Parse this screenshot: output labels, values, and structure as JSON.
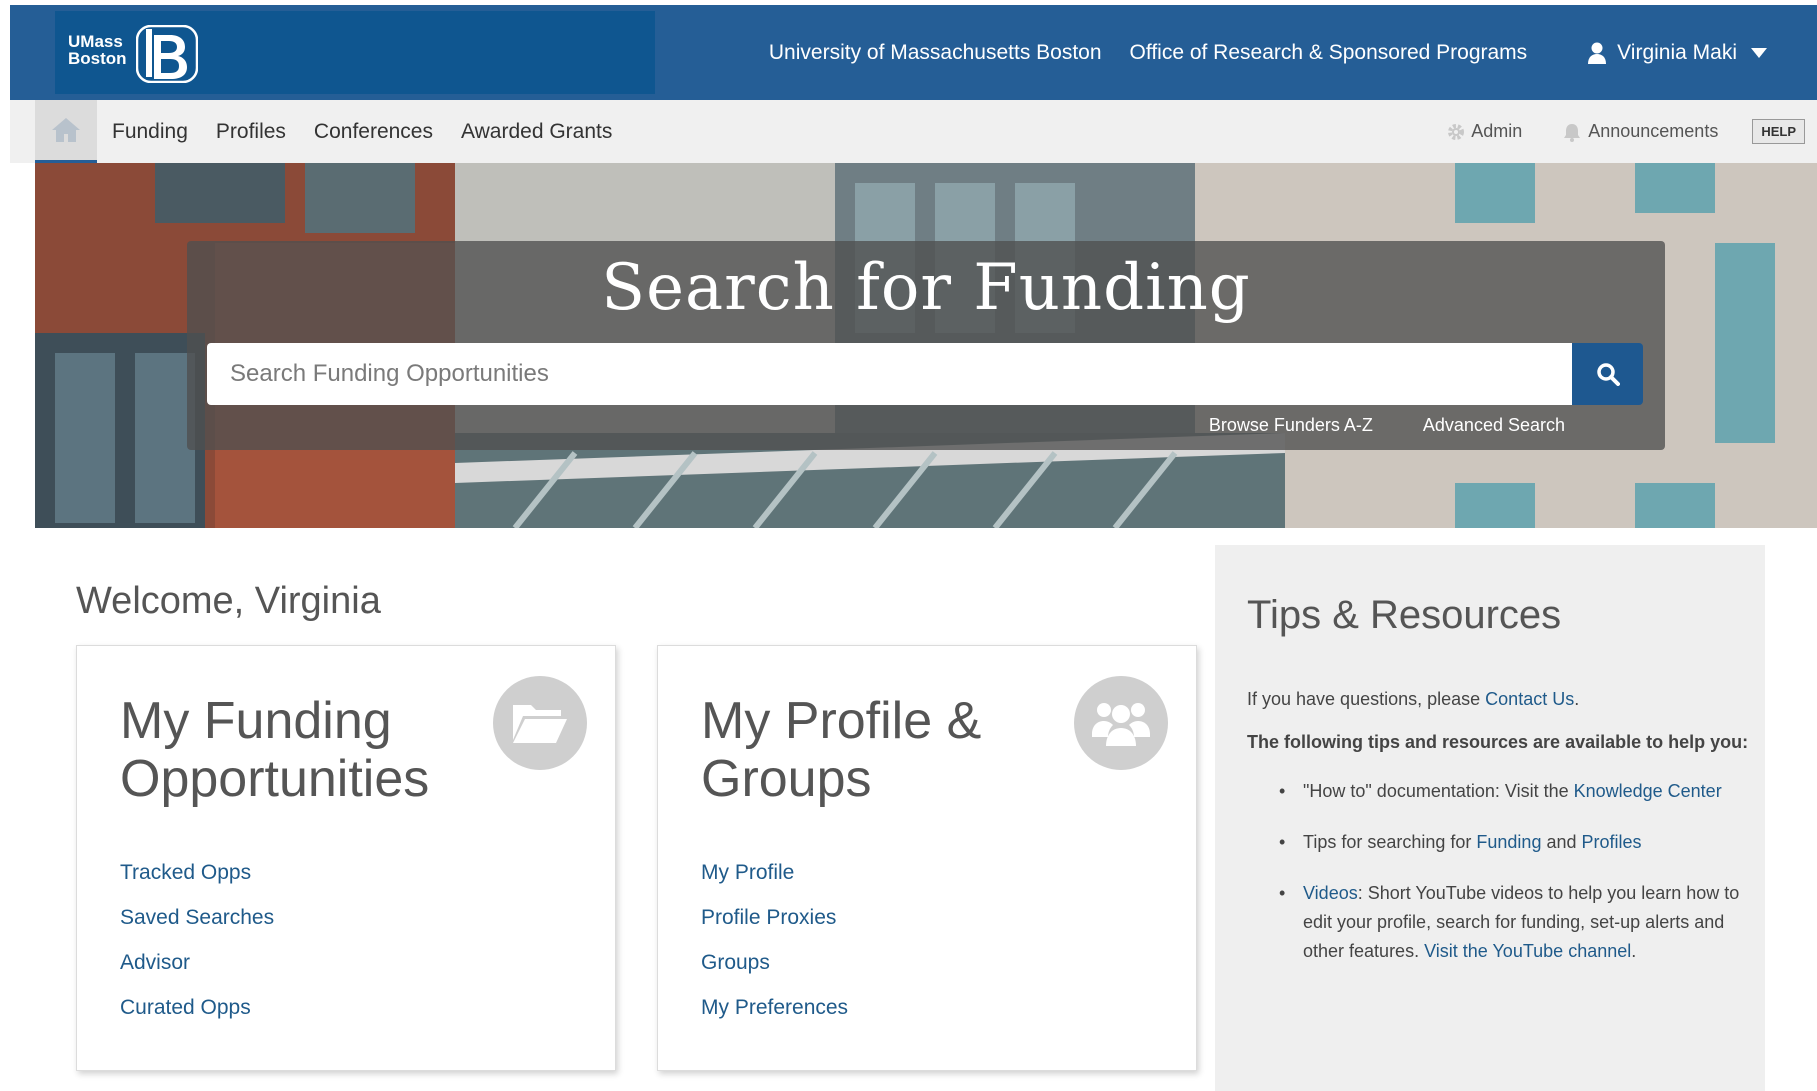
{
  "header": {
    "logo_text_line1": "UMass",
    "logo_text_line2": "Boston",
    "links": [
      "University of Massachusetts Boston",
      "Office of Research & Sponsored Programs"
    ],
    "user_name": "Virginia Maki"
  },
  "nav": {
    "items": [
      "Funding",
      "Profiles",
      "Conferences",
      "Awarded Grants"
    ],
    "admin_label": "Admin",
    "announcements_label": "Announcements",
    "help_label": "HELP"
  },
  "hero": {
    "title": "Search for Funding",
    "search_placeholder": "Search Funding Opportunities",
    "browse_link": "Browse Funders A-Z",
    "advanced_link": "Advanced Search"
  },
  "welcome": "Welcome, Virginia",
  "funding_card": {
    "title_line1": "My Funding",
    "title_line2": "Opportunities",
    "links": [
      "Tracked Opps",
      "Saved Searches",
      "Advisor",
      "Curated Opps"
    ]
  },
  "profile_card": {
    "title_line1": "My Profile &",
    "title_line2": "Groups",
    "links": [
      "My Profile",
      "Profile Proxies",
      "Groups",
      "My Preferences"
    ]
  },
  "tips": {
    "title": "Tips & Resources",
    "intro": "If you have questions, please ",
    "contact_link": "Contact Us",
    "intro_end": ".",
    "lead": "The following tips and resources are available to help you:",
    "item1_text": "\"How to\" documentation: Visit the ",
    "item1_link": "Knowledge Center",
    "item2_text": "Tips for searching for ",
    "item2_link1": "Funding",
    "item2_mid": " and ",
    "item2_link2": "Profiles",
    "item3_link1": "Videos",
    "item3_text": ": Short YouTube videos to help you learn how to edit your profile, search for funding, set-up alerts and other features. ",
    "item3_link2": "Visit the YouTube channel",
    "item3_end": "."
  },
  "colors": {
    "header_bg": "#255e96",
    "logo_bg": "#0f5690",
    "link": "#1f5a8a",
    "search_button": "#1e5890"
  }
}
